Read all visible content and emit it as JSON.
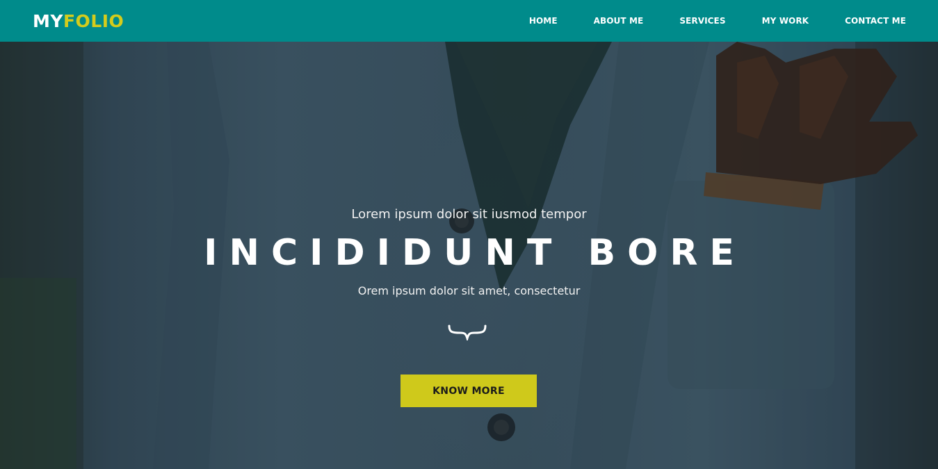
{
  "brand": {
    "part1": "MY",
    "part2": "FOLIO"
  },
  "nav": {
    "items": [
      {
        "label": "HOME"
      },
      {
        "label": "ABOUT ME"
      },
      {
        "label": "SERVICES"
      },
      {
        "label": "MY WORK"
      },
      {
        "label": "CONTACT ME"
      }
    ]
  },
  "hero": {
    "pretitle": "Lorem ipsum dolor sit iusmod tempor",
    "title": "INCIDIDUNT BORE",
    "subtitle": "Orem ipsum dolor sit amet, consectetur",
    "divider_icon": "curly-brace-icon",
    "cta_label": "KNOW MORE",
    "background_image": "jacket-photo"
  },
  "colors": {
    "navbar": "#008b8b",
    "brand_accent": "#d4cc1c",
    "cta_background": "#cfc91b",
    "text": "#ffffff"
  }
}
